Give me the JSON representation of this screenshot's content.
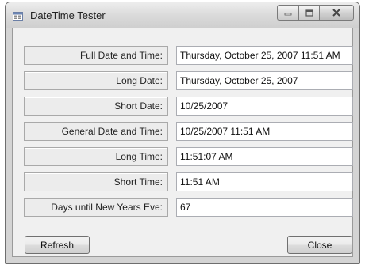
{
  "window": {
    "title": "DateTime Tester",
    "app_icon": "form-icon"
  },
  "caption_buttons": {
    "minimize_icon": "minimize-icon",
    "maximize_icon": "maximize-icon",
    "close_icon": "close-icon"
  },
  "fields": [
    {
      "label": "Full Date and Time:",
      "value": "Thursday, October 25, 2007 11:51 AM"
    },
    {
      "label": "Long Date:",
      "value": "Thursday, October 25, 2007"
    },
    {
      "label": "Short Date:",
      "value": "10/25/2007"
    },
    {
      "label": "General Date and Time:",
      "value": "10/25/2007 11:51 AM"
    },
    {
      "label": "Long Time:",
      "value": "11:51:07 AM"
    },
    {
      "label": "Short Time:",
      "value": "11:51 AM"
    },
    {
      "label": "Days until New Years Eve:",
      "value": "67"
    }
  ],
  "buttons": {
    "refresh": "Refresh",
    "close": "Close"
  }
}
